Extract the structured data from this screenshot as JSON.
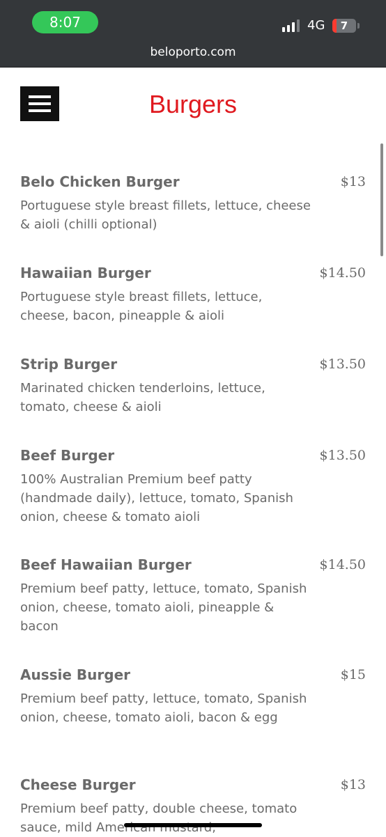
{
  "status_bar": {
    "time": "8:07",
    "network": "4G",
    "battery": "7",
    "battery_level": 0.07,
    "signal_bars": 3
  },
  "browser": {
    "url": "beloporto.com"
  },
  "header": {
    "title": "Burgers",
    "title_color": "#e0191f",
    "menu_icon": "hamburger-menu-icon"
  },
  "menu_items": [
    {
      "name": "Belo Chicken Burger",
      "price": "$13",
      "description": "Portuguese style breast fillets, lettuce, cheese & aioli (chilli optional)"
    },
    {
      "name": "Hawaiian Burger",
      "price": "$14.50",
      "description": "Portuguese style breast fillets, lettuce, cheese, bacon, pineapple & aioli"
    },
    {
      "name": "Strip Burger",
      "price": "$13.50",
      "description": "Marinated chicken tenderloins, lettuce, tomato, cheese & aioli"
    },
    {
      "name": "Beef Burger",
      "price": "$13.50",
      "description": "100% Australian Premium beef patty (handmade daily), lettuce, tomato, Spanish onion, cheese & tomato aioli"
    },
    {
      "name": "Beef Hawaiian Burger",
      "price": "$14.50",
      "description": "Premium beef patty, lettuce, tomato, Spanish onion, cheese, tomato aioli, pineapple & bacon"
    },
    {
      "name": "Aussie Burger",
      "price": "$15",
      "description": "Premium beef patty, lettuce, tomato, Spanish onion, cheese, tomato aioli, bacon & egg"
    },
    {
      "name": "Cheese Burger",
      "price": "$13",
      "description": "Premium beef patty, double cheese, tomato sauce, mild American mustard,"
    }
  ]
}
